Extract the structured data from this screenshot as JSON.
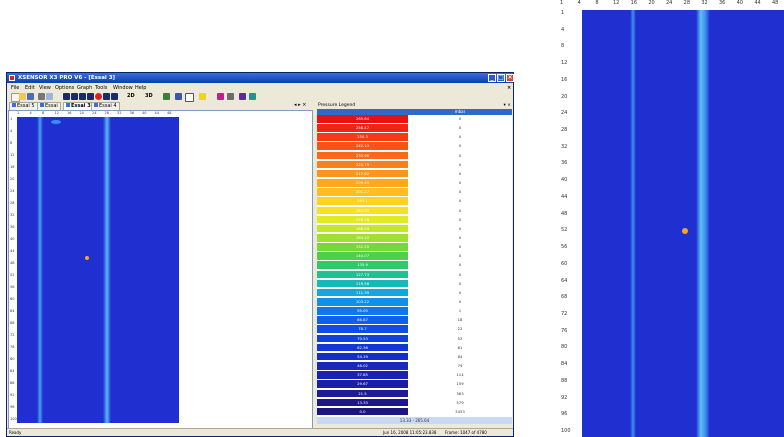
{
  "window": {
    "title": "XSENSOR X3 PRO V6 - [Essai 3]",
    "minimize_glyph": "_",
    "maximize_glyph": "□",
    "close_glyph": "×",
    "doc_close_glyph": "×"
  },
  "menu": [
    "File",
    "Edit",
    "View",
    "Options",
    "Graph",
    "Tools",
    "Window",
    "Help"
  ],
  "toolbar": {
    "view2d_label": "2D",
    "view3d_label": "3D",
    "icons": [
      "new-icon",
      "open-icon",
      "save-icon",
      "print-icon",
      "preview-icon",
      "first-frame-icon",
      "prev-frame-icon",
      "play-back-icon",
      "stop-icon",
      "record-icon",
      "play-icon",
      "last-frame-icon",
      "view-2d-icon",
      "view-3d-icon",
      "graph-icon",
      "grid-icon",
      "window-icon",
      "paint-icon",
      "color-bar-icon",
      "palette-icon",
      "zoom-icon",
      "overflow-icon"
    ]
  },
  "tabs": [
    "Essai 5",
    "Essai",
    "Essai 3",
    "Essai 4"
  ],
  "active_tab_index": 2,
  "tab_nav": "◂ ▸ ×",
  "axes": {
    "columns": [
      "1",
      "4",
      "8",
      "12",
      "16",
      "20",
      "24",
      "28",
      "32",
      "36",
      "40",
      "44",
      "48"
    ],
    "rows": [
      "1",
      "4",
      "8",
      "12",
      "16",
      "20",
      "24",
      "28",
      "32",
      "36",
      "40",
      "44",
      "48",
      "52",
      "56",
      "60",
      "64",
      "68",
      "72",
      "76",
      "80",
      "84",
      "88",
      "92",
      "96",
      "100"
    ],
    "big_columns": [
      "1",
      "4",
      "8",
      "12",
      "16",
      "20",
      "24",
      "28",
      "32",
      "36",
      "40",
      "44",
      "48"
    ],
    "big_rows": [
      "1",
      "4",
      "8",
      "12",
      "16",
      "20",
      "24",
      "28",
      "32",
      "36",
      "40",
      "44",
      "48",
      "52",
      "56",
      "60",
      "64",
      "68",
      "72",
      "76",
      "80",
      "84",
      "88",
      "92",
      "96",
      "100"
    ]
  },
  "legend": {
    "pane_title": "Pressure Legend",
    "pane_controls": "▾ ×",
    "unit": "mbar",
    "range": "13.33 - 265.64",
    "rows": [
      {
        "value": "265.64",
        "count": "0",
        "color": "#e81010"
      },
      {
        "value": "258.47",
        "count": "0",
        "color": "#f02412"
      },
      {
        "value": "250.3",
        "count": "0",
        "color": "#f53a14"
      },
      {
        "value": "242.13",
        "count": "0",
        "color": "#f75318"
      },
      {
        "value": "233.96",
        "count": "0",
        "color": "#f86a18"
      },
      {
        "value": "225.79",
        "count": "0",
        "color": "#f9801a"
      },
      {
        "value": "217.62",
        "count": "0",
        "color": "#fa961c"
      },
      {
        "value": "209.45",
        "count": "0",
        "color": "#fbaa1e"
      },
      {
        "value": "201.27",
        "count": "0",
        "color": "#fcbe20"
      },
      {
        "value": "193.1",
        "count": "0",
        "color": "#fdd222"
      },
      {
        "value": "184.93",
        "count": "0",
        "color": "#f6e224"
      },
      {
        "value": "176.76",
        "count": "0",
        "color": "#e2ea26"
      },
      {
        "value": "168.59",
        "count": "0",
        "color": "#c3e82a"
      },
      {
        "value": "160.42",
        "count": "0",
        "color": "#a0e030"
      },
      {
        "value": "152.25",
        "count": "0",
        "color": "#78d838"
      },
      {
        "value": "144.07",
        "count": "0",
        "color": "#50d048"
      },
      {
        "value": "135.9",
        "count": "0",
        "color": "#30c868"
      },
      {
        "value": "127.73",
        "count": "0",
        "color": "#20c090"
      },
      {
        "value": "119.56",
        "count": "0",
        "color": "#18b8b8"
      },
      {
        "value": "111.39",
        "count": "0",
        "color": "#14a8d8"
      },
      {
        "value": "103.22",
        "count": "0",
        "color": "#1090e8"
      },
      {
        "value": "95.05",
        "count": "1",
        "color": "#1078ee"
      },
      {
        "value": "86.87",
        "count": "18",
        "color": "#1060ec"
      },
      {
        "value": "78.7",
        "count": "22",
        "color": "#104ce6"
      },
      {
        "value": "70.53",
        "count": "52",
        "color": "#1240de"
      },
      {
        "value": "62.36",
        "count": "61",
        "color": "#1436d4"
      },
      {
        "value": "54.19",
        "count": "84",
        "color": "#162ec8"
      },
      {
        "value": "46.02",
        "count": "79",
        "color": "#1828bc"
      },
      {
        "value": "37.85",
        "count": "114",
        "color": "#1a22b0"
      },
      {
        "value": "29.67",
        "count": "159",
        "color": "#1c1ea4"
      },
      {
        "value": "21.5",
        "count": "363",
        "color": "#1e1a98"
      },
      {
        "value": "13.33",
        "count": "579",
        "color": "#20168c"
      },
      {
        "value": "0.0",
        "count": "3453",
        "color": "#1c1480"
      }
    ]
  },
  "status": {
    "left": "Ready",
    "date": "Jun 16, 2008   11:05:23.838",
    "frames": "Frame: 1047 of 4780"
  }
}
